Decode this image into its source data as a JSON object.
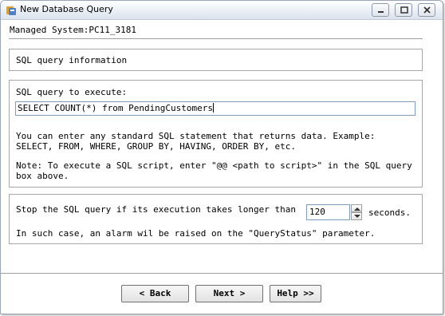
{
  "window": {
    "title": "New Database Query",
    "icon": "app-icon",
    "controls": [
      "minimize-icon",
      "maximize-icon",
      "close-icon"
    ]
  },
  "header": {
    "managed_system": "Managed System:PC11_3181"
  },
  "info_section": {
    "label": "SQL query information"
  },
  "query_section": {
    "label": "SQL query to execute:",
    "query_value": "SELECT COUNT(*) from PendingCustomers",
    "help_line1": "You can enter any standard SQL statement that returns data. Example:",
    "help_line2": "SELECT, FROM, WHERE, GROUP BY, HAVING, ORDER BY, etc.",
    "note_line1": "Note: To execute a SQL script, enter \"@@ <path to script>\" in the SQL query",
    "note_line2": "box above."
  },
  "timeout_section": {
    "label": "Stop the SQL query if its execution takes longer than",
    "value": "120",
    "unit": "seconds.",
    "alarm_text": "In such case, an alarm wil be raised on the \"QueryStatus\" parameter."
  },
  "buttons": {
    "back": "< Back",
    "next": "Next >",
    "help": "Help >>"
  }
}
